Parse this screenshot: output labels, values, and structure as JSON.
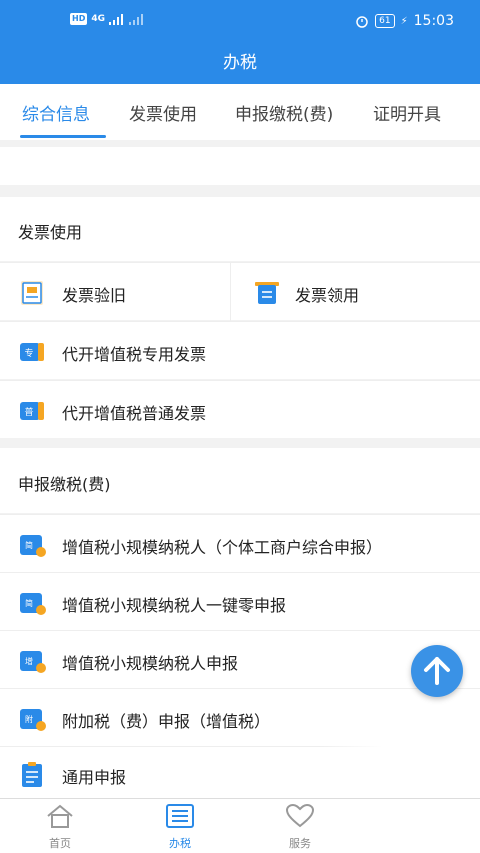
{
  "status_bar": {
    "left_badge": "HD",
    "network": "4G",
    "battery": "61",
    "time": "15:03"
  },
  "header": {
    "title": "办税"
  },
  "tabs": [
    {
      "label": "综合信息",
      "active": true
    },
    {
      "label": "发票使用",
      "active": false
    },
    {
      "label": "申报缴税(费)",
      "active": false
    },
    {
      "label": "证明开具",
      "active": false
    }
  ],
  "sections": {
    "invoice": {
      "title": "发票使用",
      "items": [
        {
          "label": "发票验旧",
          "icon": "invoice-check-icon"
        },
        {
          "label": "发票领用",
          "icon": "invoice-receive-icon"
        },
        {
          "label": "代开增值税专用发票",
          "icon": "special-invoice-icon",
          "badge": "专"
        },
        {
          "label": "代开增值税普通发票",
          "icon": "ordinary-invoice-icon",
          "badge": "普"
        }
      ]
    },
    "tax": {
      "title": "申报缴税(费)",
      "items": [
        {
          "label": "增值税小规模纳税人（个体工商户综合申报）",
          "icon": "tax-declare-icon",
          "badge": "简"
        },
        {
          "label": "增值税小规模纳税人一键零申报",
          "icon": "tax-declare-icon",
          "badge": "简"
        },
        {
          "label": "增值税小规模纳税人申报",
          "icon": "tax-declare-icon",
          "badge": "增"
        },
        {
          "label": "附加税（费）申报（增值税）",
          "icon": "tax-declare-icon",
          "badge": "附"
        },
        {
          "label": "通用申报",
          "icon": "general-declare-icon"
        }
      ]
    }
  },
  "bottom_nav": [
    {
      "label": "首页",
      "active": false
    },
    {
      "label": "办税",
      "active": true
    },
    {
      "label": "服务",
      "active": false
    }
  ],
  "colors": {
    "primary": "#2a8ae8",
    "accent_orange": "#f5a623"
  }
}
